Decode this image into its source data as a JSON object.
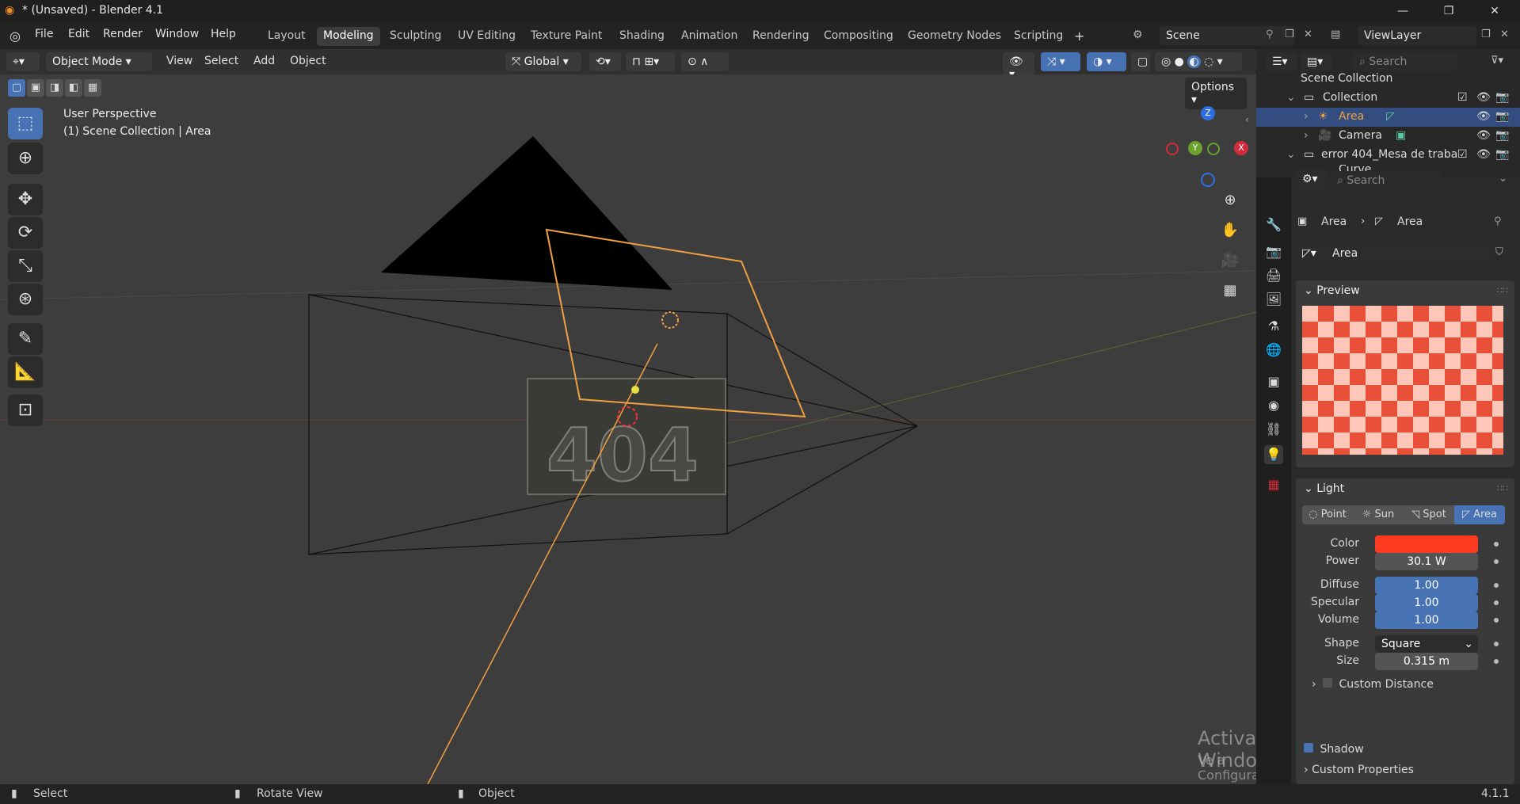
{
  "window": {
    "title": "* (Unsaved) - Blender 4.1",
    "controls": [
      "—",
      "❐",
      "✕"
    ]
  },
  "menu": [
    "File",
    "Edit",
    "Render",
    "Window",
    "Help"
  ],
  "workspaces": [
    "Layout",
    "Modeling",
    "Sculpting",
    "UV Editing",
    "Texture Paint",
    "Shading",
    "Animation",
    "Rendering",
    "Compositing",
    "Geometry Nodes",
    "Scripting"
  ],
  "active_workspace": "Modeling",
  "scene": {
    "name": "Scene",
    "view_layer": "ViewLayer"
  },
  "viewport_header": {
    "mode": "Object Mode",
    "menus": [
      "View",
      "Select",
      "Add",
      "Object"
    ],
    "transform": "Global",
    "options": "Options"
  },
  "viewport": {
    "perspective": "User Perspective",
    "context": "(1) Scene Collection | Area",
    "axes": {
      "z": "Z",
      "y": "Y",
      "x": "X"
    }
  },
  "outliner": {
    "search_placeholder": "Search",
    "items": [
      {
        "label": "Scene Collection"
      },
      {
        "label": "Collection"
      },
      {
        "label": "Area"
      },
      {
        "label": "Camera"
      },
      {
        "label": "error 404_Mesa de traba"
      },
      {
        "label": "Curve"
      }
    ]
  },
  "properties": {
    "search_placeholder": "Search",
    "breadcrumb": [
      "Area",
      "Area"
    ],
    "datablock_name": "Area",
    "preview_title": "Preview",
    "light_title": "Light",
    "light_types": [
      "Point",
      "Sun",
      "Spot",
      "Area"
    ],
    "active_light_type": "Area",
    "fields": {
      "color_label": "Color",
      "color_value": "#ff3b22",
      "power_label": "Power",
      "power_value": "30.1 W",
      "diffuse_label": "Diffuse",
      "diffuse_value": "1.00",
      "specular_label": "Specular",
      "specular_value": "1.00",
      "volume_label": "Volume",
      "volume_value": "1.00",
      "shape_label": "Shape",
      "shape_value": "Square",
      "size_label": "Size",
      "size_value": "0.315 m"
    },
    "custom_distance": "Custom Distance",
    "shadow": "Shadow",
    "custom_properties": "Custom Properties"
  },
  "watermark": {
    "line1": "Activar Windows",
    "line2": "Ve a Configuración para activar Windows."
  },
  "statusbar": {
    "select": "Select",
    "rotate": "Rotate View",
    "object": "Object",
    "version": "4.1.1"
  },
  "colors": {
    "accent": "#4772b3",
    "selection": "#334d80",
    "light_orange": "#f0a040",
    "light_color": "#ff3b22"
  }
}
